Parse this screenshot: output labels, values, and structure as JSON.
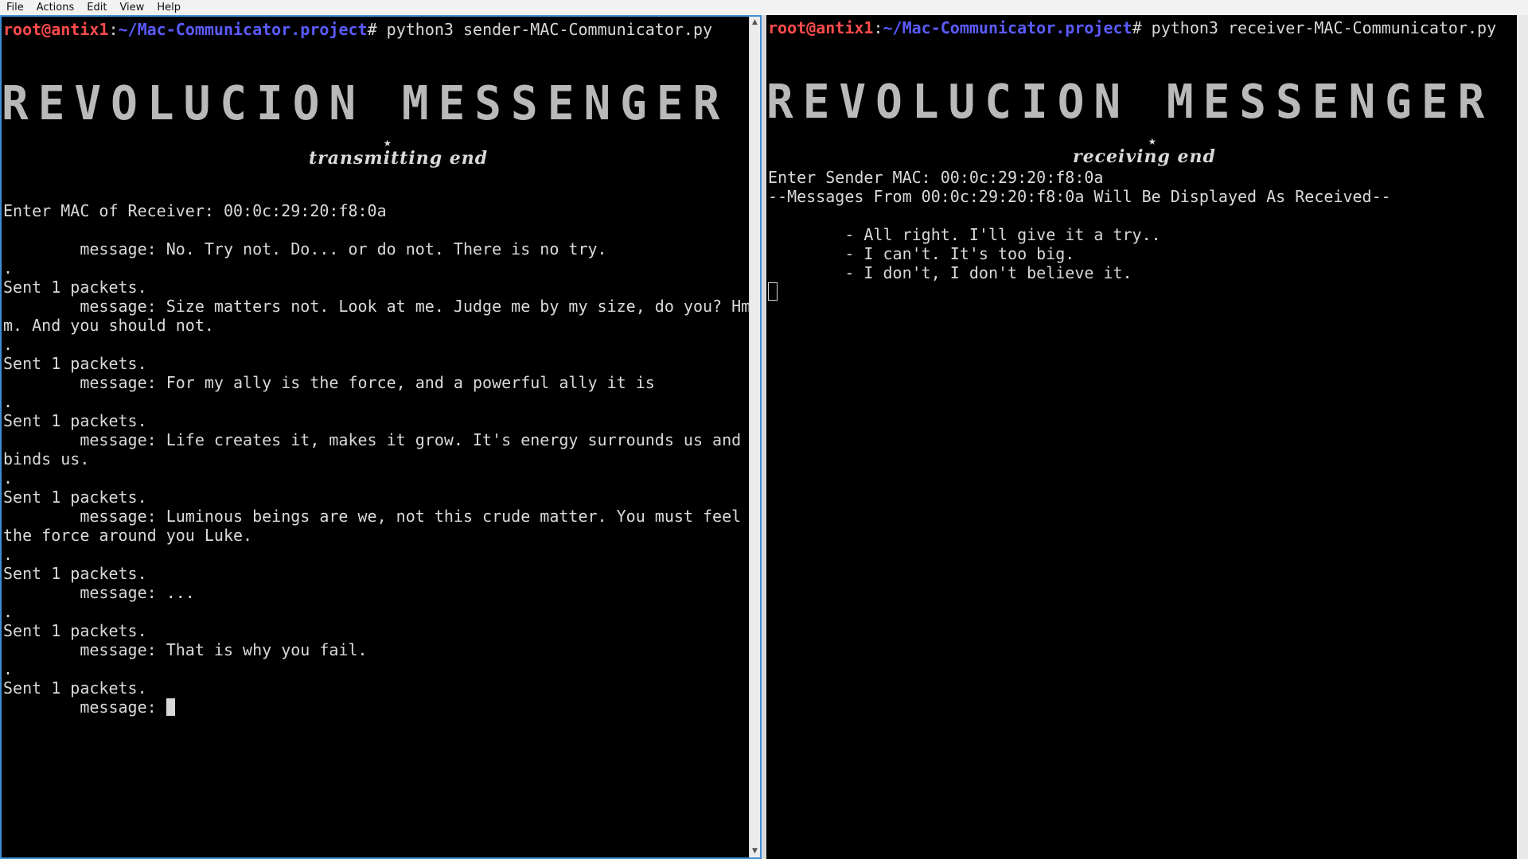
{
  "menubar": {
    "items": [
      "File",
      "Actions",
      "Edit",
      "View",
      "Help"
    ]
  },
  "sender": {
    "prompt_user": "root@antix1",
    "prompt_path": "~/Mac-Communicator.project",
    "prompt_suffix": "# python3 sender-MAC-Communicator.py",
    "banner": "REVOLUCION MESSENGER",
    "star": "★",
    "subtitle": "transmitting end",
    "lines": [
      "Enter MAC of Receiver: 00:0c:29:20:f8:0a",
      "",
      "        message: No. Try not. Do... or do not. There is no try.",
      ".",
      "Sent 1 packets.",
      "        message: Size matters not. Look at me. Judge me by my size, do you? Hm",
      "m. And you should not.",
      ".",
      "Sent 1 packets.",
      "        message: For my ally is the force, and a powerful ally it is",
      ".",
      "Sent 1 packets.",
      "        message: Life creates it, makes it grow. It's energy surrounds us and",
      "binds us.",
      ".",
      "Sent 1 packets.",
      "        message: Luminous beings are we, not this crude matter. You must feel",
      "the force around you Luke.",
      ".",
      "Sent 1 packets.",
      "        message: ...",
      ".",
      "Sent 1 packets.",
      "        message: That is why you fail.",
      ".",
      "Sent 1 packets."
    ],
    "input_label": "        message: ",
    "input_value": ""
  },
  "receiver": {
    "prompt_user": "root@antix1",
    "prompt_path": "~/Mac-Communicator.project",
    "prompt_suffix": "# python3 receiver-MAC-Communicator.py",
    "banner": "REVOLUCION MESSENGER",
    "star": "★",
    "subtitle": "receiving end",
    "lines": [
      "Enter Sender MAC: 00:0c:29:20:f8:0a",
      "--Messages From 00:0c:29:20:f8:0a Will Be Displayed As Received--",
      "",
      "        - All right. I'll give it a try..",
      "        - I can't. It's too big.",
      "        - I don't, I don't believe it."
    ]
  }
}
